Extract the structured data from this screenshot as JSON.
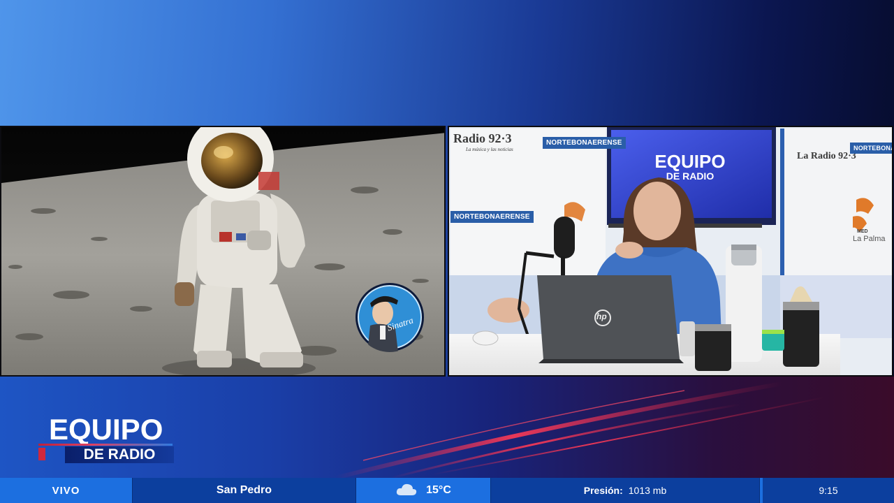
{
  "left_panel": {
    "badge_signature": "Sinatra"
  },
  "right_panel": {
    "radio_logo": "Radio 92·3",
    "radio_tagline": "La música y las noticias",
    "sponsor_top": "NORTEBONAERENSE",
    "sponsor_mid": "NORTEBONAERENSE",
    "sponsor_right": "NORTEBONAERENSE",
    "tv_line1": "EQUIPO",
    "tv_line2": "DE RADIO",
    "right_radio_logo": "La Radio 92·3",
    "med_label": "MED",
    "la_palma": "La Palma",
    "laptop_brand": "hp"
  },
  "brand": {
    "line1": "EQUIPO",
    "line2": "DE RADIO"
  },
  "ticker": {
    "live": "VIVO",
    "city": "San Pedro",
    "temperature": "15°C",
    "pressure_label": "Presión:",
    "pressure_value": "1013 mb",
    "time": "9:15"
  },
  "colors": {
    "ticker_bg": "#0c3f9e",
    "ticker_accent": "#1c6fe0",
    "brand_red": "#d0283c"
  }
}
